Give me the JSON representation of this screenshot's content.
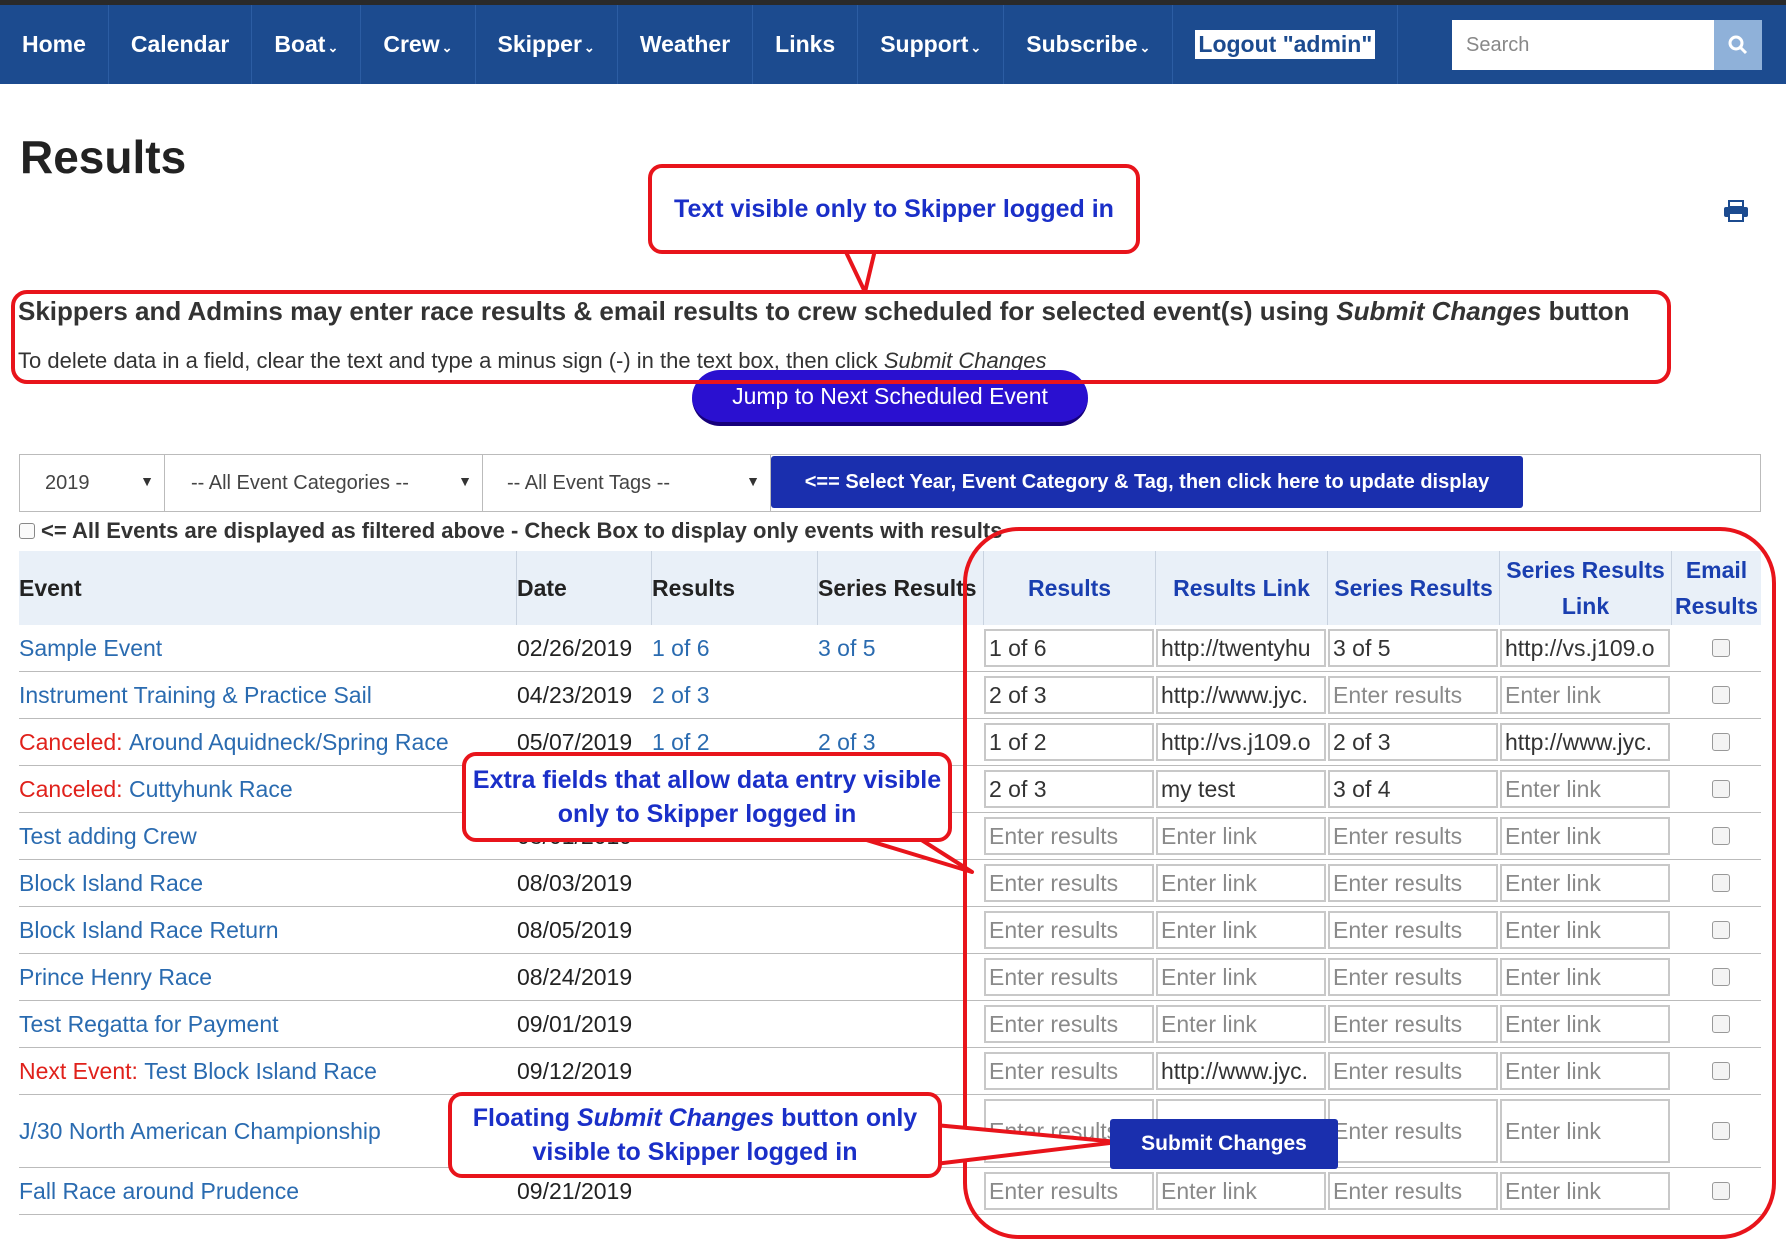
{
  "nav": {
    "items": [
      {
        "label": "Home",
        "dropdown": false
      },
      {
        "label": "Calendar",
        "dropdown": false
      },
      {
        "label": "Boat",
        "dropdown": true
      },
      {
        "label": "Crew",
        "dropdown": true
      },
      {
        "label": "Skipper",
        "dropdown": true
      },
      {
        "label": "Weather",
        "dropdown": false
      },
      {
        "label": "Links",
        "dropdown": false
      },
      {
        "label": "Support",
        "dropdown": true
      },
      {
        "label": "Subscribe",
        "dropdown": true
      }
    ],
    "logout": "Logout \"admin\"",
    "search_placeholder": "Search",
    "search_icon": "search-icon"
  },
  "page_title": "Results",
  "print_icon": "printer-icon",
  "annotations": {
    "top": "Text visible only to Skipper logged in",
    "middle": "Extra fields that allow data entry visible only to Skipper logged in",
    "bottom_pre": "Floating ",
    "bottom_em": "Submit Changes",
    "bottom_post": " button only visible to Skipper logged in"
  },
  "info": {
    "line1_pre": "Skippers and Admins may enter race results & email results to crew scheduled for selected event(s) using ",
    "line1_em": "Submit Changes",
    "line1_post": " button",
    "line2_pre": "To delete data in a field, clear the text and type a minus sign (-) in the text box, then click ",
    "line2_em": "Submit Changes"
  },
  "jump_button": "Jump to Next Scheduled Event",
  "filters": {
    "year": "2019",
    "category": "-- All Event Categories --",
    "tags": "-- All Event Tags --",
    "update_button": "<== Select Year, Event Category & Tag, then click here to update display",
    "only_results_label": "<= All Events are displayed as filtered above - Check Box to display only events with results"
  },
  "table": {
    "headers": {
      "event": "Event",
      "date": "Date",
      "results": "Results",
      "series": "Series Results",
      "in_results": "Results",
      "in_link": "Results Link",
      "in_series": "Series Results",
      "in_series_link_1": "Series Results",
      "in_series_link_2": "Link",
      "email_1": "Email",
      "email_2": "Results"
    },
    "rows": [
      {
        "prefix": "",
        "event": "Sample Event",
        "date": "02/26/2019",
        "results": "1 of 6",
        "series": "3 of 5",
        "in_results": "1 of 6",
        "in_link": "http://twentyhu",
        "in_series": "3 of 5",
        "in_series_link": "http://vs.j109.o"
      },
      {
        "prefix": "",
        "event": "Instrument Training & Practice Sail",
        "date": "04/23/2019",
        "results": "2 of 3",
        "series": "",
        "in_results": "2 of 3",
        "in_link": "http://www.jyc.",
        "in_series": "",
        "in_series_link": ""
      },
      {
        "prefix": "Canceled: ",
        "event": "Around Aquidneck/Spring Race",
        "date": "05/07/2019",
        "results": "1 of 2",
        "series": "2 of 3",
        "in_results": "1 of 2",
        "in_link": "http://vs.j109.o",
        "in_series": "2 of 3",
        "in_series_link": "http://www.jyc."
      },
      {
        "prefix": "Canceled: ",
        "event": "Cuttyhunk Race",
        "date": "",
        "results": "",
        "series": "",
        "in_results": "2 of 3",
        "in_link": "my test",
        "in_series": "3 of 4",
        "in_series_link": ""
      },
      {
        "prefix": "",
        "event": "Test adding Crew",
        "date": "08/01/2019",
        "results": "",
        "series": "",
        "in_results": "",
        "in_link": "",
        "in_series": "",
        "in_series_link": ""
      },
      {
        "prefix": "",
        "event": "Block Island Race",
        "date": "08/03/2019",
        "results": "",
        "series": "",
        "in_results": "",
        "in_link": "",
        "in_series": "",
        "in_series_link": ""
      },
      {
        "prefix": "",
        "event": "Block Island Race Return",
        "date": "08/05/2019",
        "results": "",
        "series": "",
        "in_results": "",
        "in_link": "",
        "in_series": "",
        "in_series_link": ""
      },
      {
        "prefix": "",
        "event": "Prince Henry Race",
        "date": "08/24/2019",
        "results": "",
        "series": "",
        "in_results": "",
        "in_link": "",
        "in_series": "",
        "in_series_link": ""
      },
      {
        "prefix": "",
        "event": "Test Regatta for Payment",
        "date": "09/01/2019",
        "results": "",
        "series": "",
        "in_results": "",
        "in_link": "",
        "in_series": "",
        "in_series_link": ""
      },
      {
        "prefix": "Next Event: ",
        "event": "Test Block Island Race",
        "date": "09/12/2019",
        "results": "",
        "series": "",
        "in_results": "",
        "in_link": "http://www.jyc.",
        "in_series": "",
        "in_series_link": ""
      },
      {
        "prefix": "",
        "event": "J/30 North American Championship",
        "date": "",
        "results": "",
        "series": "",
        "in_results": "",
        "in_link": "",
        "in_series": "",
        "in_series_link": ""
      },
      {
        "prefix": "",
        "event": "Fall Race around Prudence",
        "date": "09/21/2019",
        "results": "",
        "series": "",
        "in_results": "",
        "in_link": "",
        "in_series": "",
        "in_series_link": ""
      }
    ],
    "placeholders": {
      "results": "Enter results",
      "link": "Enter link"
    }
  },
  "submit_button": "Submit Changes",
  "colors": {
    "nav": "#1c4b8f",
    "accent": "#1a2fae",
    "annotation": "#e8141b",
    "link": "#2a6bb0",
    "canceled": "#e0211b"
  }
}
